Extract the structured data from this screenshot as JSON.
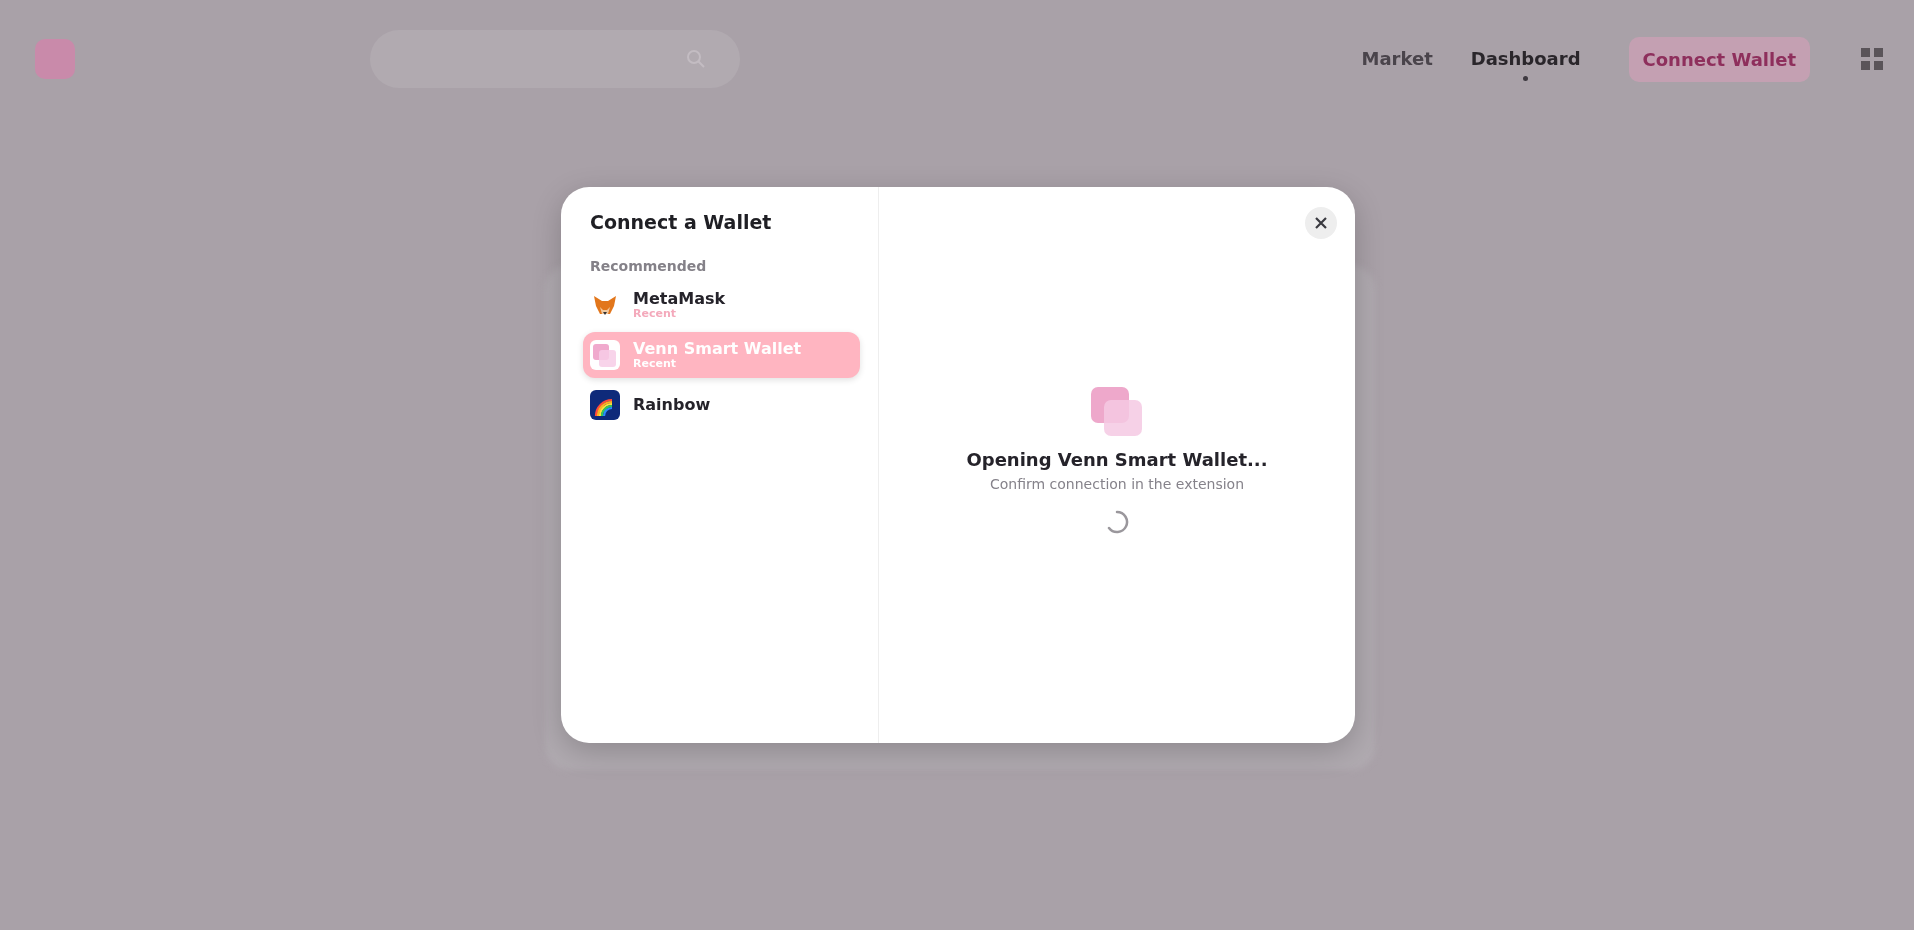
{
  "header": {
    "nav": [
      {
        "label": "Market",
        "selected": false
      },
      {
        "label": "Dashboard",
        "selected": true
      }
    ],
    "connect_button": "Connect Wallet"
  },
  "modal": {
    "title": "Connect a Wallet",
    "section": "Recommended",
    "wallets": [
      {
        "name": "MetaMask",
        "tag": "Recent",
        "selected": false,
        "kind": "fox"
      },
      {
        "name": "Venn Smart Wallet",
        "tag": "Recent",
        "selected": true,
        "kind": "venn"
      },
      {
        "name": "Rainbow",
        "selected": false,
        "kind": "rainbow"
      }
    ],
    "status": {
      "title": "Opening Venn Smart Wallet...",
      "subtitle": "Confirm connection in the extension"
    }
  }
}
